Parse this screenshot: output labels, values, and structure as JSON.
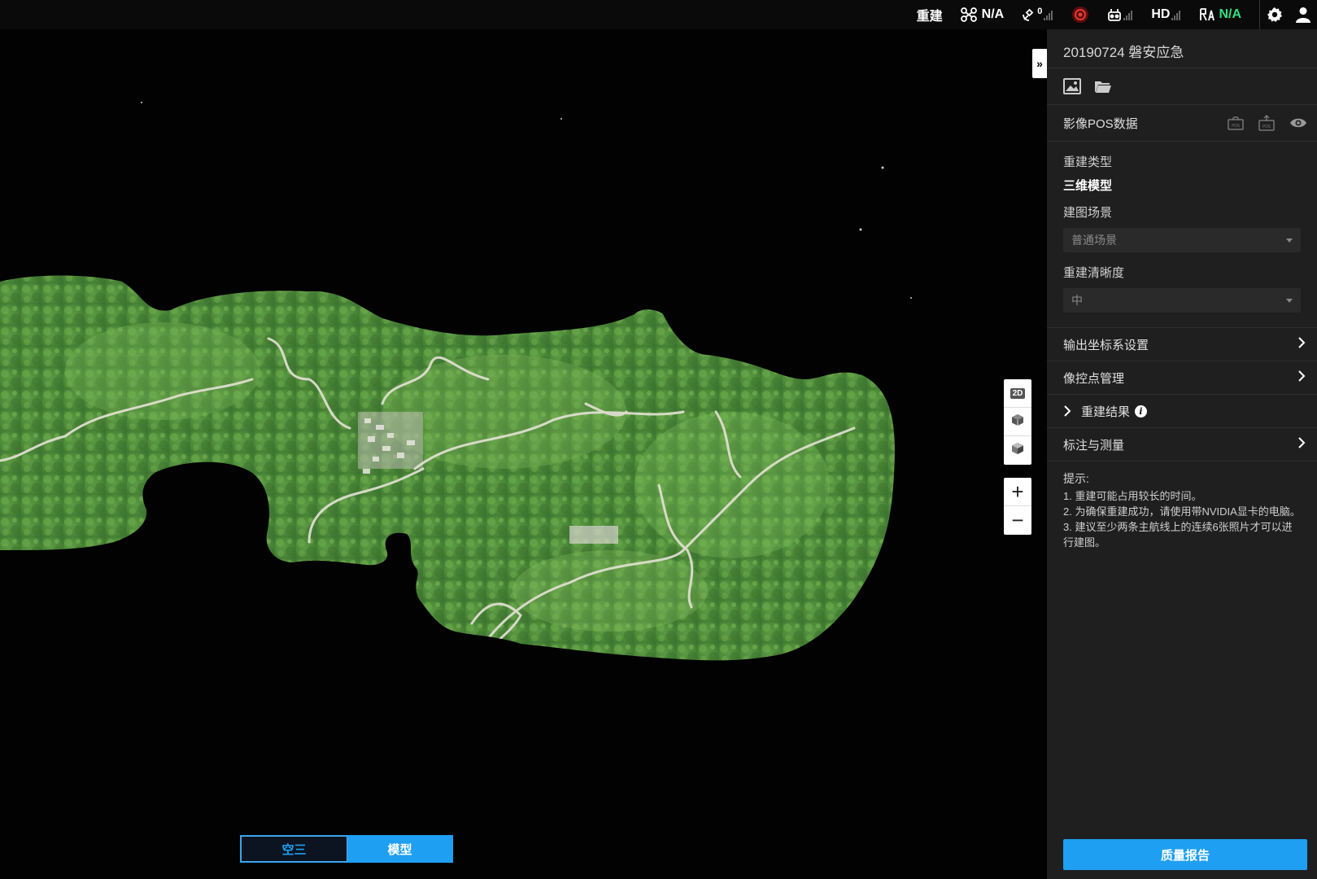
{
  "topbar": {
    "rebuild_label": "重建",
    "drone_status": "N/A",
    "gps_count": "0",
    "hd_label": "HD",
    "rtk_status": "N/A",
    "icons": [
      "drone-icon",
      "satellite-icon",
      "recording-icon",
      "remote-controller-icon",
      "rtk-icon",
      "settings-icon",
      "user-icon"
    ],
    "status_colors": {
      "ok": "#2fe07f",
      "alert": "#e53935"
    }
  },
  "map": {
    "collapse_label": "»",
    "view_tools": [
      "2D",
      "3d-cube-icon",
      "3d-model-icon"
    ],
    "zoom_in_label": "+",
    "zoom_out_label": "−",
    "mode_tabs": [
      {
        "label": "空三",
        "active": false
      },
      {
        "label": "模型",
        "active": true
      }
    ]
  },
  "panel": {
    "title": "20190724 磐安应急",
    "pos_data_label": "影像POS数据",
    "reconstruction_type_label": "重建类型",
    "reconstruction_type_value": "三维模型",
    "scene_label": "建图场景",
    "scene_value": "普通场景",
    "clarity_label": "重建清晰度",
    "clarity_value": "中",
    "nav": {
      "output_crs": "输出坐标系设置",
      "gcp": "像控点管理",
      "results": "重建结果",
      "annotation": "标注与测量"
    },
    "tips": {
      "heading": "提示:",
      "lines": [
        "1. 重建可能占用较长的时间。",
        "2. 为确保重建成功，请使用带NVIDIA显卡的电脑。",
        "3. 建议至少两条主航线上的连续6张照片才可以进行建图。"
      ]
    },
    "report_button": "质量报告",
    "accent_color": "#1e9ff2"
  }
}
